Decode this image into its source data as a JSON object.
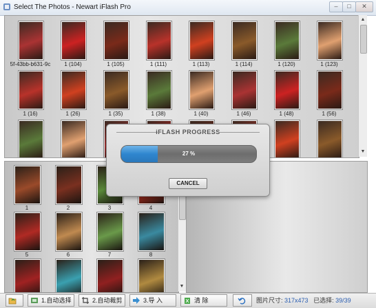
{
  "window": {
    "title": "Select The Photos - Newart iFlash Pro",
    "min": "–",
    "max": "□",
    "close": "✕"
  },
  "top_grid": {
    "rows": [
      {
        "labels": [
          "5f-43bb-b631-9c",
          "1 (104)",
          "1 (105)",
          "1 (111)",
          "1 (113)",
          "1 (114)",
          "1 (120)",
          "1 (123)"
        ]
      },
      {
        "labels": [
          "1 (16)",
          "1 (26)",
          "1 (35)",
          "1 (38)",
          "1 (40)",
          "1 (46)",
          "1 (48)",
          "1 (56)"
        ]
      },
      {
        "labels": [
          "",
          "",
          "",
          "",
          "",
          "",
          "",
          ""
        ]
      }
    ]
  },
  "bottom_grid": {
    "labels": [
      "1",
      "2",
      "3",
      "4",
      "5",
      "6",
      "7",
      "8",
      "",
      "",
      "",
      ""
    ]
  },
  "dialog": {
    "title": "iFLASH PROGRESS",
    "progress_percent": 27,
    "progress_text": "27 %",
    "cancel_label": "CANCEL"
  },
  "toolbar": {
    "buttons": [
      {
        "label": "",
        "icon": "folder-open-icon"
      },
      {
        "label": "1.自动选择",
        "icon": "auto-select-icon"
      },
      {
        "label": "2.自动裁剪",
        "icon": "crop-icon"
      },
      {
        "label": "3.导 入",
        "icon": "import-arrow-icon"
      },
      {
        "label": "清 除",
        "icon": "clear-icon"
      },
      {
        "label": "",
        "icon": "undo-icon"
      }
    ],
    "status": {
      "size_label": "图片尺寸:",
      "size_value": "317x473",
      "selected_label": "已选择:",
      "selected_value": "39/39"
    }
  },
  "colors": {
    "progress_fill": "#2f86cf",
    "status_value": "#2a5db0"
  }
}
